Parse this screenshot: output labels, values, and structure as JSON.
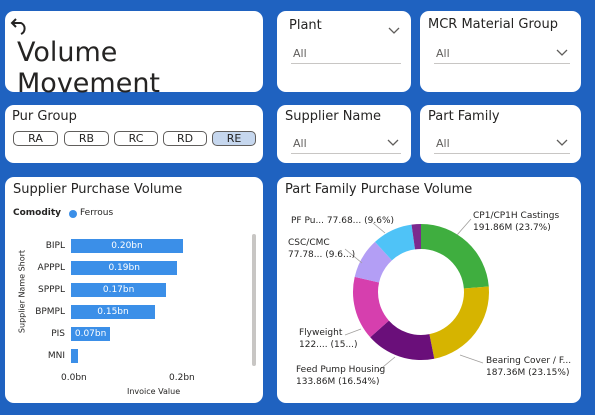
{
  "title_card": {
    "title": "Volume Movement"
  },
  "plant": {
    "label": "Plant",
    "value": "All"
  },
  "mcr": {
    "label": "MCR Material Group",
    "value": "All"
  },
  "pur_group": {
    "label": "Pur Group",
    "options": [
      "RA",
      "RB",
      "RC",
      "RD",
      "RE"
    ],
    "selected": "RE"
  },
  "supplier": {
    "label": "Supplier Name",
    "value": "All"
  },
  "part_family_filter": {
    "label": "Part Family",
    "value": "All"
  },
  "supplier_chart": {
    "title": "Supplier Purchase Volume",
    "legend_title": "Comodity",
    "legend_item": "Ferrous",
    "x_ticks": [
      "0.0bn",
      "0.2bn"
    ]
  },
  "part_chart": {
    "title": "Part Family Purchase Volume"
  },
  "colors": {
    "accent": "#3b8fe8",
    "background": "#1f62c0",
    "selected_pill": "#c6d7ee"
  },
  "chart_data": [
    {
      "type": "bar",
      "orientation": "horizontal",
      "title": "Supplier Purchase Volume",
      "xlabel": "Invoice Value",
      "ylabel": "Supplier Name Short",
      "legend": {
        "title": "Comodity",
        "items": [
          "Ferrous"
        ]
      },
      "categories": [
        "BIPL",
        "APPPL",
        "SPPPL",
        "BPMPL",
        "PIS",
        "MNI"
      ],
      "values": [
        0.2,
        0.19,
        0.17,
        0.15,
        0.07,
        0.012
      ],
      "data_labels": [
        "0.20bn",
        "0.19bn",
        "0.17bn",
        "0.15bn",
        "0.07bn",
        ""
      ],
      "units": "bn",
      "xlim": [
        0,
        0.2
      ]
    },
    {
      "type": "pie",
      "variant": "donut",
      "title": "Part Family Purchase Volume",
      "slices": [
        {
          "label": "CP1/CP1H Castings",
          "value_text": "191.86M (23.7%)",
          "value": 191.86,
          "color": "#3fae3f"
        },
        {
          "label": "Bearing Cover / F...",
          "value_text": "187.36M (23.15%)",
          "value": 187.36,
          "color": "#d6b400"
        },
        {
          "label": "Feed Pump Housing",
          "value_text": "133.86M (16.54%)",
          "value": 133.86,
          "color": "#6a0f7a"
        },
        {
          "label": "Flyweight",
          "value_text": "122.... (15...)",
          "value": 122.5,
          "color": "#d63fae"
        },
        {
          "label": "CSC/CMC",
          "value_text": "77.78... (9.6...)",
          "value": 77.78,
          "color": "#b39ef5"
        },
        {
          "label": "PF Pu...",
          "value_text": "77.68... (9.6%)",
          "value": 77.68,
          "color": "#4fc3f7"
        },
        {
          "label": "",
          "value_text": "",
          "value": 18.0,
          "color": "#7b2a8e"
        }
      ]
    }
  ]
}
